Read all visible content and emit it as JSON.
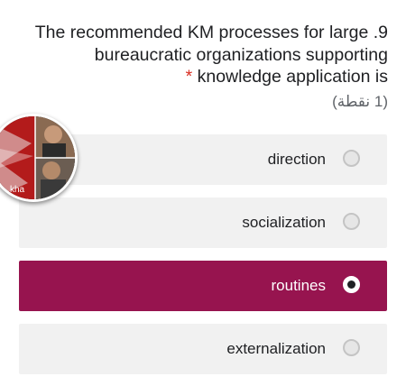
{
  "question": {
    "line1": "The recommended KM processes for large .9",
    "line2": "bureaucratic organizations supporting",
    "required_star": "*",
    "line3": "knowledge application is",
    "points": "(1 نقطة)"
  },
  "options": [
    {
      "label": "direction",
      "selected": false
    },
    {
      "label": "socialization",
      "selected": false
    },
    {
      "label": "routines",
      "selected": true
    },
    {
      "label": "externalization",
      "selected": false
    }
  ],
  "avatar": {
    "text": "kha"
  },
  "colors": {
    "selected_bg": "#97144f",
    "option_bg": "#f1f1f1",
    "required": "#d93025",
    "radio_unchecked": "#e6e6e6"
  }
}
